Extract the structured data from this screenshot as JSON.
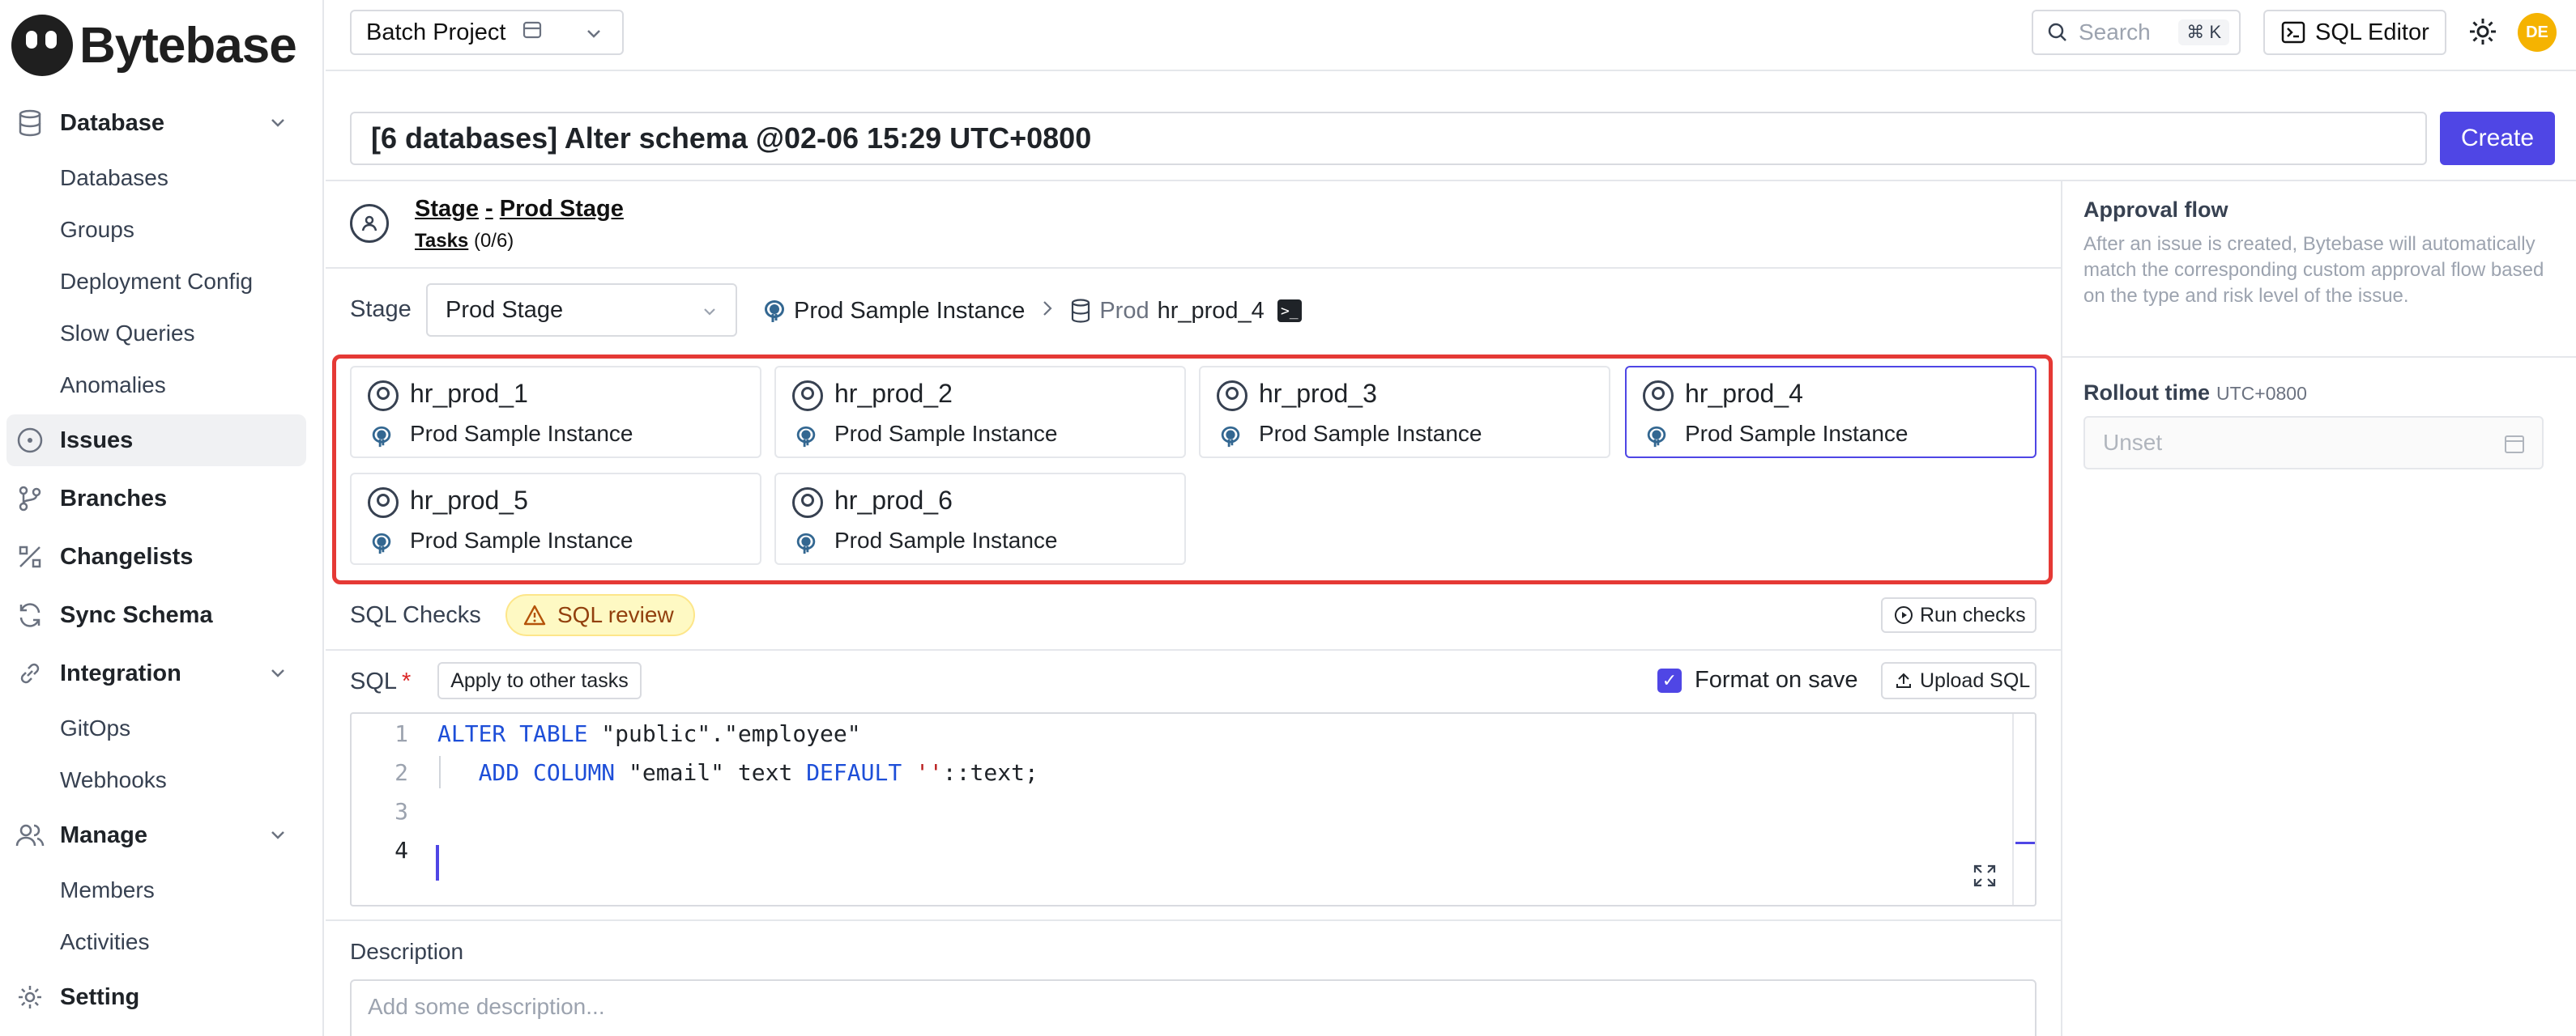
{
  "app": {
    "brand": "Bytebase"
  },
  "sidebar": {
    "database_group": "Database",
    "database_items": [
      "Databases",
      "Groups",
      "Deployment Config",
      "Slow Queries",
      "Anomalies"
    ],
    "issues": "Issues",
    "branches": "Branches",
    "changelists": "Changelists",
    "sync_schema": "Sync Schema",
    "integration_group": "Integration",
    "integration_items": [
      "GitOps",
      "Webhooks"
    ],
    "manage_group": "Manage",
    "manage_items": [
      "Members",
      "Activities"
    ],
    "setting": "Setting"
  },
  "topbar": {
    "project": "Batch Project",
    "search_placeholder": "Search",
    "search_shortcut": "⌘ K",
    "sql_editor": "SQL Editor",
    "avatar_initials": "DE"
  },
  "issue": {
    "title": "[6 databases] Alter schema @02-06 15:29 UTC+0800",
    "create_label": "Create"
  },
  "stage": {
    "breadcrumb_stage": "Stage",
    "breadcrumb_dash": "-",
    "breadcrumb_name": "Prod Stage",
    "tasks_label": "Tasks",
    "tasks_count": "(0/6)",
    "select_label": "Stage",
    "select_value": "Prod Stage",
    "instance": "Prod Sample Instance",
    "env": "Prod",
    "database": "hr_prod_4"
  },
  "tasks": [
    {
      "name": "hr_prod_1",
      "instance": "Prod Sample Instance"
    },
    {
      "name": "hr_prod_2",
      "instance": "Prod Sample Instance"
    },
    {
      "name": "hr_prod_3",
      "instance": "Prod Sample Instance"
    },
    {
      "name": "hr_prod_4",
      "instance": "Prod Sample Instance",
      "selected": true
    },
    {
      "name": "hr_prod_5",
      "instance": "Prod Sample Instance"
    },
    {
      "name": "hr_prod_6",
      "instance": "Prod Sample Instance"
    }
  ],
  "checks": {
    "label": "SQL Checks",
    "badge": "SQL review",
    "run": "Run checks"
  },
  "sql": {
    "label": "SQL",
    "required_mark": "*",
    "apply": "Apply to other tasks",
    "format_on_save": "Format on save",
    "format_checked": true,
    "upload": "Upload SQL",
    "line_numbers": [
      "1",
      "2",
      "3",
      "4"
    ]
  },
  "description": {
    "label": "Description",
    "placeholder": "Add some description..."
  },
  "right_panel": {
    "approval_title": "Approval flow",
    "approval_desc": "After an issue is created, Bytebase will automatically match the corresponding custom approval flow based on the type and risk level of the issue.",
    "rollout_label": "Rollout time",
    "rollout_tz": "UTC+0800",
    "rollout_placeholder": "Unset"
  },
  "colors": {
    "accent": "#4f46e5",
    "highlight": "#e53935",
    "avatar": "#f5b301",
    "warning_bg": "#fef9c3"
  }
}
